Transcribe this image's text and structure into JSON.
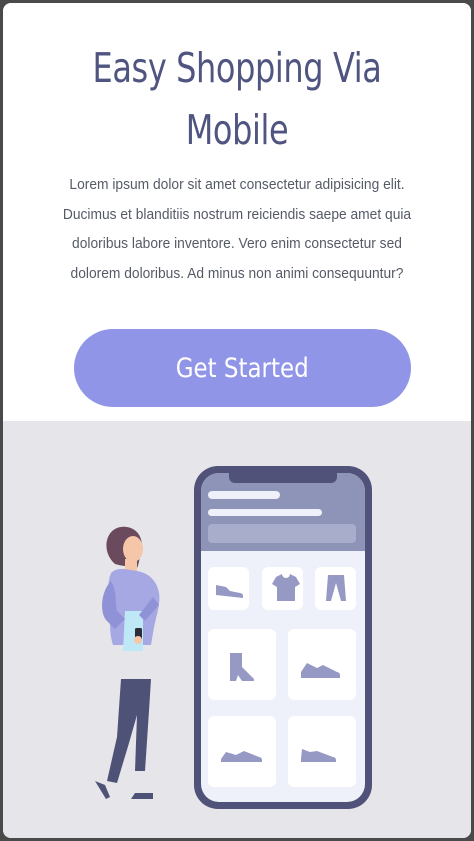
{
  "hero": {
    "title_line1": "Easy Shopping Via",
    "title_line2": "Mobile",
    "description_lines": [
      "Lorem ipsum dolor sit amet consectetur adipisicing elit.",
      "Ducimus et blanditiis nostrum reiciendis saepe amet quia",
      "doloribus labore inventore. Vero enim consectetur sed",
      "dolorem doloribus. Ad minus non animi consequuntur?"
    ],
    "cta_label": "Get Started"
  },
  "illustration": {
    "products": [
      "shoe-icon",
      "tshirt-icon",
      "pants-icon",
      "boot-icon",
      "sneaker-icon",
      "sneaker-icon",
      "sneaker-icon"
    ]
  },
  "colors": {
    "accent": "#9195e8",
    "title": "#4f5580",
    "illustration_bg": "#e6e5ea",
    "phone_frame": "#50527a"
  }
}
